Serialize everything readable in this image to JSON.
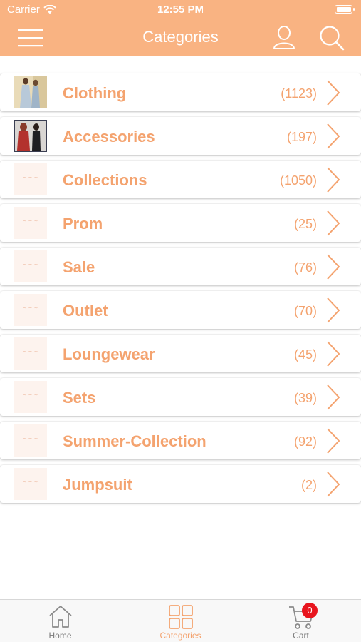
{
  "status_bar": {
    "carrier": "Carrier",
    "time": "12:55 PM"
  },
  "header": {
    "title": "Categories"
  },
  "categories": [
    {
      "label": "Clothing",
      "count": "(1123)"
    },
    {
      "label": "Accessories",
      "count": "(197)"
    },
    {
      "label": "Collections",
      "count": "(1050)"
    },
    {
      "label": "Prom",
      "count": "(25)"
    },
    {
      "label": "Sale",
      "count": "(76)"
    },
    {
      "label": "Outlet",
      "count": "(70)"
    },
    {
      "label": "Loungewear",
      "count": "(45)"
    },
    {
      "label": "Sets",
      "count": "(39)"
    },
    {
      "label": "Summer-Collection",
      "count": "(92)"
    },
    {
      "label": "Jumpsuit",
      "count": "(2)"
    }
  ],
  "tabs": [
    {
      "label": "Home",
      "icon": "home-icon"
    },
    {
      "label": "Categories",
      "icon": "grid-icon"
    },
    {
      "label": "Cart",
      "icon": "cart-icon"
    }
  ],
  "cart_badge": "0",
  "colors": {
    "accent": "#f9b382",
    "label": "#f4a36f",
    "badge": "#e8151e",
    "tab_inactive": "#7a7a7a"
  }
}
